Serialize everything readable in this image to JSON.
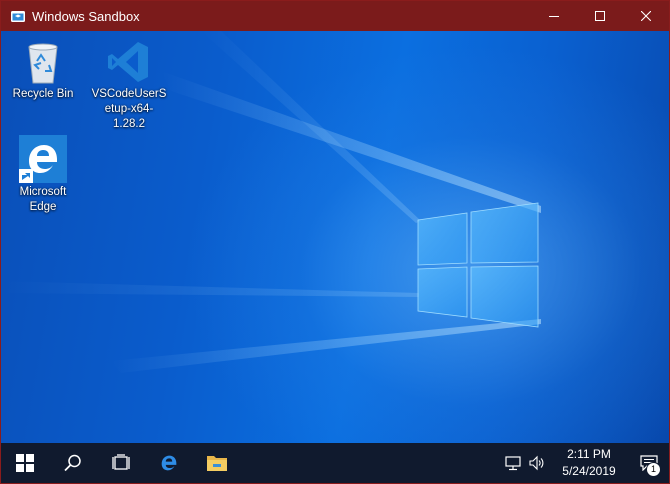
{
  "window": {
    "title": "Windows Sandbox",
    "controls": [
      "minimize",
      "maximize",
      "close"
    ]
  },
  "desktop": {
    "icons": [
      {
        "label": "Recycle Bin",
        "icon": "recycle-bin-icon"
      },
      {
        "label": "VSCodeUserSetup-x64-1.28.2",
        "icon": "vscode-icon"
      },
      {
        "label": "Microsoft Edge",
        "icon": "edge-icon"
      }
    ]
  },
  "taskbar": {
    "items": [
      "start-icon",
      "search-icon",
      "task-view-icon",
      "edge-icon",
      "file-explorer-icon"
    ],
    "tray": [
      "network-icon",
      "volume-icon"
    ],
    "time": "2:11 PM",
    "date": "5/24/2019",
    "notification_count": "1"
  },
  "colors": {
    "titlebar": "#7b1b1b",
    "taskbar": "#101a2e",
    "desktop_blue": "#0b6fe0",
    "edge_blue": "#1e7fd6"
  }
}
